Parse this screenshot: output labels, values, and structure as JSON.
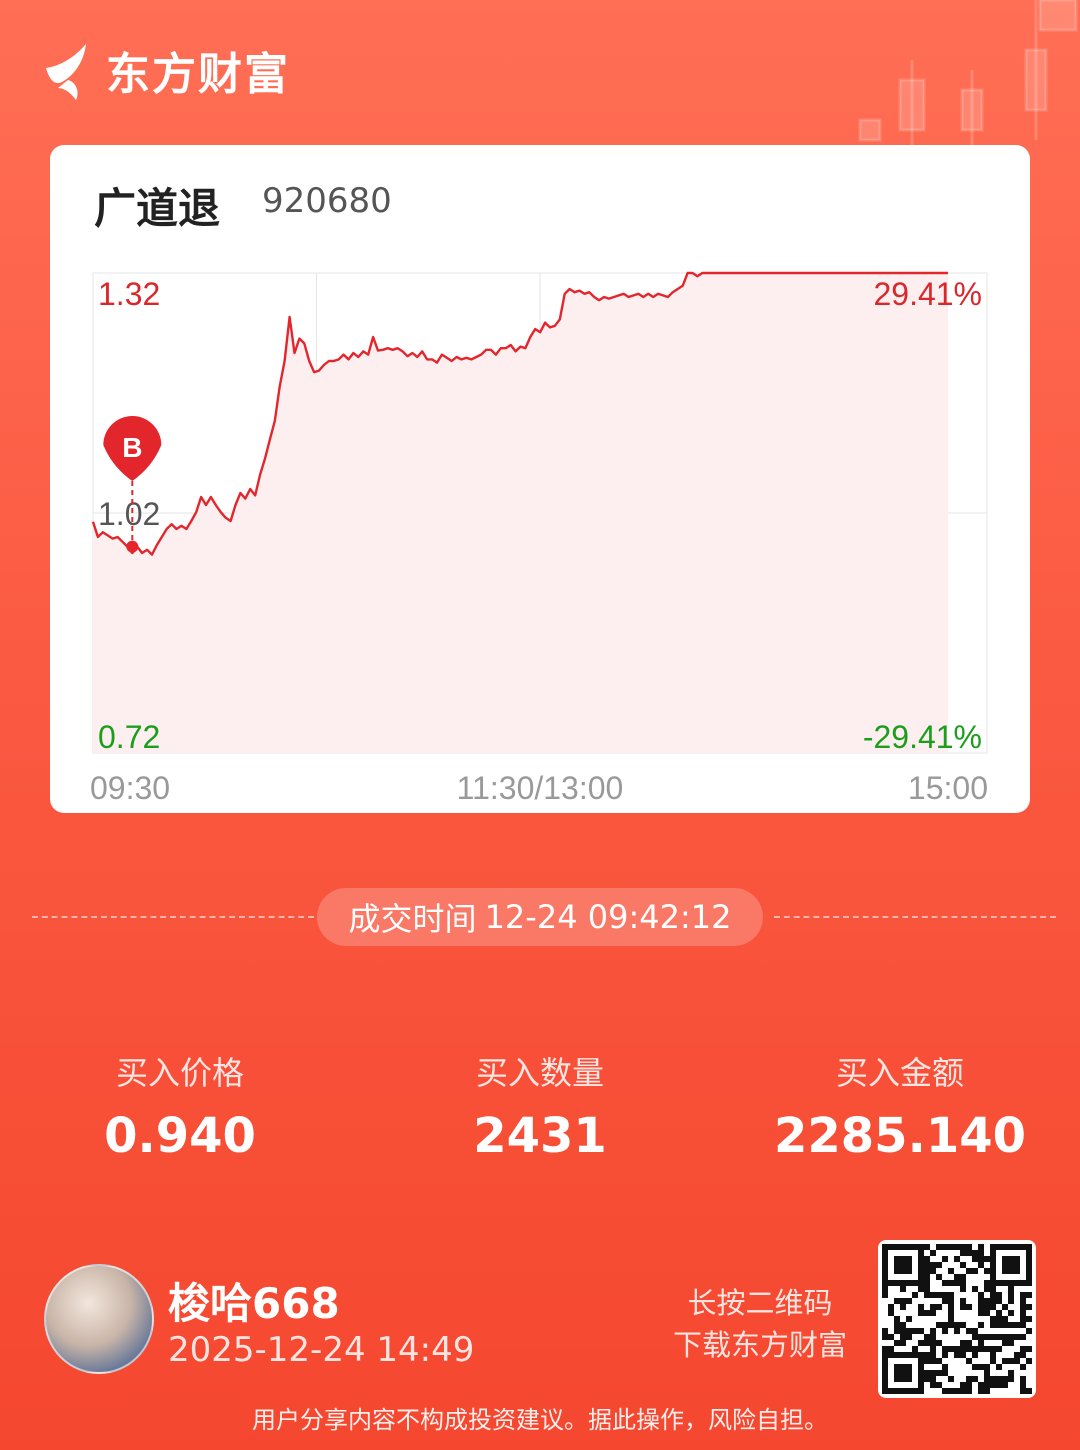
{
  "brand": {
    "name": "东方财富"
  },
  "stock": {
    "name": "广道退",
    "code": "920680"
  },
  "chart_data": {
    "type": "line",
    "x_ticks": [
      "09:30",
      "11:30/13:00",
      "15:00"
    ],
    "y_ticks_left": [
      "1.32",
      "1.02",
      "0.72"
    ],
    "y_ticks_right": [
      "29.41%",
      "-29.41%"
    ],
    "ylim": [
      0.72,
      1.32
    ],
    "reference_price": 1.02,
    "series": [
      {
        "values": [
          1.009,
          0.99,
          0.996,
          0.992,
          0.988,
          0.99,
          0.984,
          0.978,
          0.97,
          0.978,
          0.97,
          0.974,
          0.968,
          0.98,
          0.99,
          1.0,
          1.006,
          1.0,
          1.004,
          1.0,
          1.01,
          1.021,
          1.04,
          1.03,
          1.04,
          1.03,
          1.021,
          1.014,
          1.01,
          1.03,
          1.045,
          1.038,
          1.05,
          1.042,
          1.068,
          1.088,
          1.112,
          1.135,
          1.178,
          1.21,
          1.265,
          1.22,
          1.238,
          1.232,
          1.21,
          1.196,
          1.198,
          1.205,
          1.21,
          1.21,
          1.212,
          1.218,
          1.212,
          1.22,
          1.215,
          1.222,
          1.218,
          1.24,
          1.223,
          1.224,
          1.226,
          1.224,
          1.226,
          1.222,
          1.216,
          1.22,
          1.215,
          1.222,
          1.212,
          1.212,
          1.208,
          1.218,
          1.214,
          1.21,
          1.215,
          1.212,
          1.214,
          1.212,
          1.215,
          1.218,
          1.224,
          1.224,
          1.218,
          1.226,
          1.226,
          1.23,
          1.222,
          1.228,
          1.226,
          1.24,
          1.25,
          1.246,
          1.258,
          1.252,
          1.254,
          1.262,
          1.294,
          1.3,
          1.296,
          1.298,
          1.294,
          1.296,
          1.29,
          1.286,
          1.29,
          1.288,
          1.29,
          1.292,
          1.294,
          1.29,
          1.292,
          1.294,
          1.29,
          1.294,
          1.29,
          1.294,
          1.292,
          1.29,
          1.296,
          1.3,
          1.304,
          1.32,
          1.32,
          1.316,
          1.32,
          1.32,
          1.32,
          1.32,
          1.32,
          1.32,
          1.32,
          1.32,
          1.32,
          1.32,
          1.32,
          1.32,
          1.32,
          1.32,
          1.32,
          1.32,
          1.32,
          1.32,
          1.32,
          1.32,
          1.32,
          1.32,
          1.32,
          1.32,
          1.32,
          1.32,
          1.32,
          1.32,
          1.32,
          1.32,
          1.32,
          1.32,
          1.32,
          1.32,
          1.32,
          1.32,
          1.32,
          1.32,
          1.32,
          1.32,
          1.32,
          1.32,
          1.32,
          1.32,
          1.32,
          1.32,
          1.32,
          1.32,
          1.32,
          1.32,
          1.32
        ]
      }
    ],
    "marker": {
      "label": "B",
      "index": 8,
      "value": 0.978
    },
    "colors": {
      "line": "#e3262c",
      "fill": "#fdeff0",
      "up": "#d9282c",
      "down": "#1b9e1b",
      "neutral": "#555555",
      "grid": "#e6e6e6"
    }
  },
  "trade_time": {
    "label": "成交时间",
    "value": "12-24 09:42:12"
  },
  "stats": [
    {
      "label": "买入价格",
      "value": "0.940"
    },
    {
      "label": "买入数量",
      "value": "2431"
    },
    {
      "label": "买入金额",
      "value": "2285.140"
    }
  ],
  "user": {
    "name": "梭哈668",
    "timestamp": "2025-12-24 14:49"
  },
  "qr_hint": {
    "line1": "长按二维码",
    "line2": "下载东方财富"
  },
  "disclaimer": "用户分享内容不构成投资建议。据此操作，风险自担。"
}
